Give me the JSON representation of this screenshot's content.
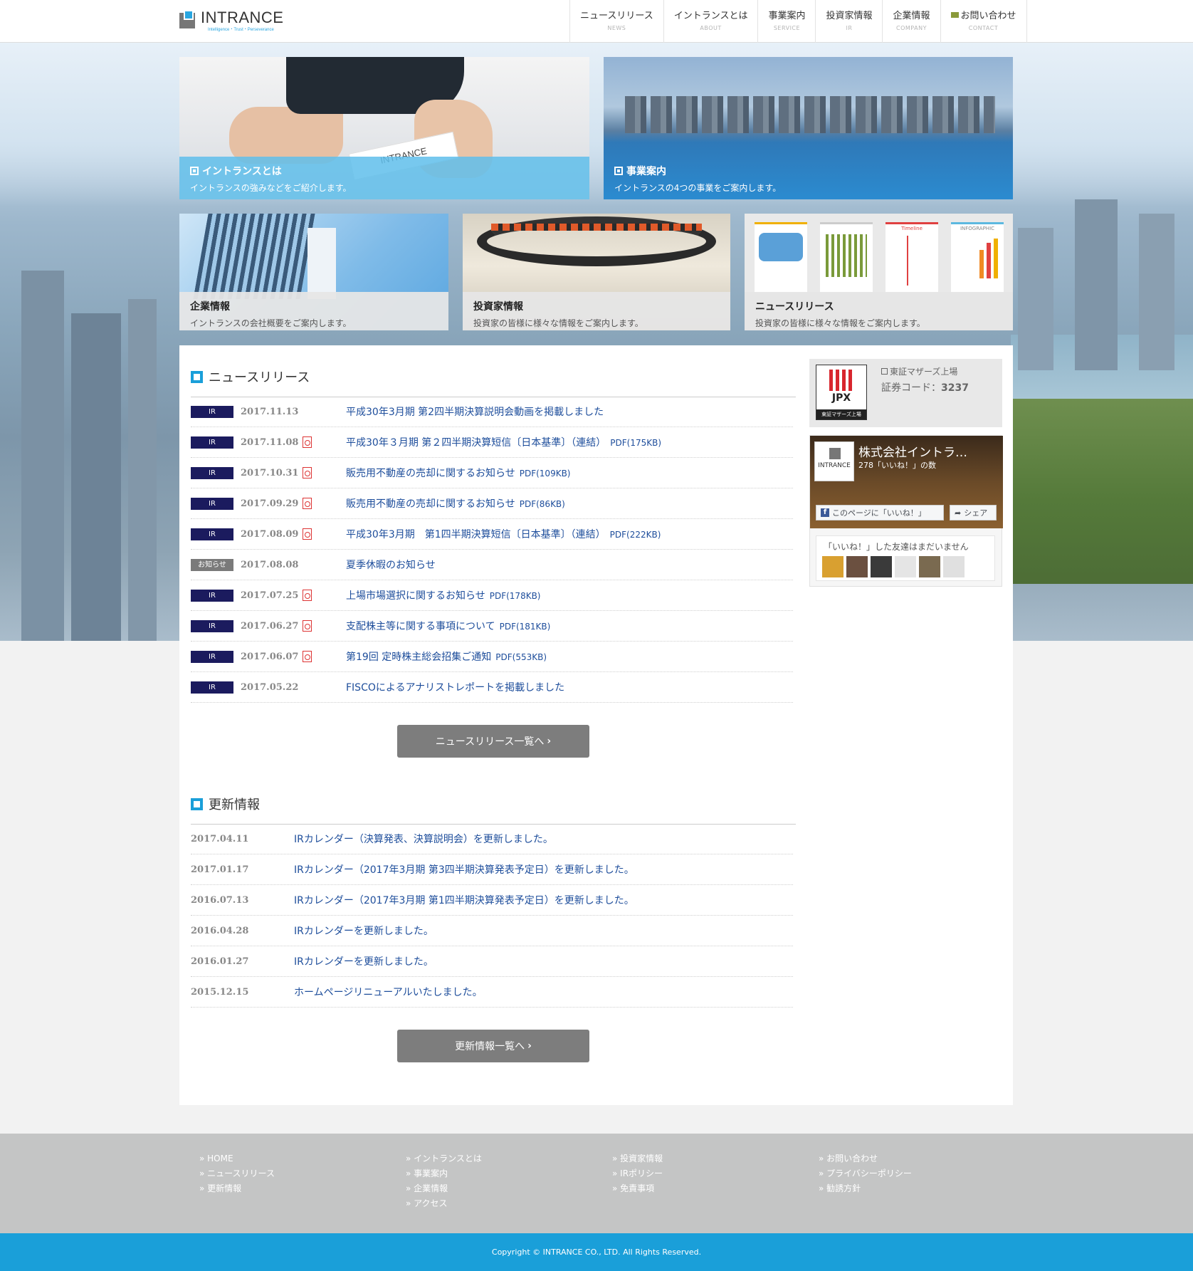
{
  "header": {
    "logo_text": "INTRANCE",
    "logo_sub": "Intelligence・Trust・Perseverance",
    "nav": [
      {
        "jp": "ニュースリリース",
        "en": "NEWS"
      },
      {
        "jp": "イントランスとは",
        "en": "ABOUT"
      },
      {
        "jp": "事業案内",
        "en": "SERVICE"
      },
      {
        "jp": "投資家情報",
        "en": "IR"
      },
      {
        "jp": "企業情報",
        "en": "COMPANY"
      },
      {
        "jp": "お問い合わせ",
        "en": "CONTACT"
      }
    ]
  },
  "tiles": {
    "about": {
      "title": "イントランスとは",
      "desc": "イントランスの強みなどをご紹介します。",
      "card_text": "INTRANCE"
    },
    "service": {
      "title": "事業案内",
      "desc": "イントランスの4つの事業をご案内します。"
    },
    "company": {
      "title": "企業情報",
      "desc": "イントランスの会社概要をご案内します。"
    },
    "ir": {
      "title": "投資家情報",
      "desc": "投資家の皆様に様々な情報をご案内します。"
    },
    "news": {
      "title": "ニュースリリース",
      "desc": "投資家の皆様に様々な情報をご案内します。",
      "infographic": "INFOGRAPHIC",
      "timeline": "Timeline"
    }
  },
  "news": {
    "heading": "ニュースリリース",
    "items": [
      {
        "tag": "IR",
        "date": "2017.11.13",
        "title": "平成30年3月期 第2四半期決算説明会動画を掲載しました",
        "pdf": false,
        "size": ""
      },
      {
        "tag": "IR",
        "date": "2017.11.08",
        "title": "平成30年３月期 第２四半期決算短信〔日本基準〕（連結）",
        "pdf": true,
        "size": "PDF(175KB)"
      },
      {
        "tag": "IR",
        "date": "2017.10.31",
        "title": "販売用不動産の売却に関するお知らせ",
        "pdf": true,
        "size": "PDF(109KB)"
      },
      {
        "tag": "IR",
        "date": "2017.09.29",
        "title": "販売用不動産の売却に関するお知らせ",
        "pdf": true,
        "size": "PDF(86KB)"
      },
      {
        "tag": "IR",
        "date": "2017.08.09",
        "title": "平成30年3月期　第1四半期決算短信〔日本基準〕（連結）",
        "pdf": true,
        "size": "PDF(222KB)"
      },
      {
        "tag": "お知らせ",
        "date": "2017.08.08",
        "title": "夏季休暇のお知らせ",
        "pdf": false,
        "size": ""
      },
      {
        "tag": "IR",
        "date": "2017.07.25",
        "title": "上場市場選択に関するお知らせ",
        "pdf": true,
        "size": "PDF(178KB)"
      },
      {
        "tag": "IR",
        "date": "2017.06.27",
        "title": "支配株主等に関する事項について",
        "pdf": true,
        "size": "PDF(181KB)"
      },
      {
        "tag": "IR",
        "date": "2017.06.07",
        "title": "第19回 定時株主総会招集ご通知",
        "pdf": true,
        "size": "PDF(553KB)"
      },
      {
        "tag": "IR",
        "date": "2017.05.22",
        "title": "FISCOによるアナリストレポートを掲載しました",
        "pdf": false,
        "size": ""
      }
    ],
    "more_label": "ニュースリリース一覧へ"
  },
  "updates": {
    "heading": "更新情報",
    "items": [
      {
        "date": "2017.04.11",
        "title": "IRカレンダー（決算発表、決算説明会）を更新しました。"
      },
      {
        "date": "2017.01.17",
        "title": "IRカレンダー（2017年3月期 第3四半期決算発表予定日）を更新しました。"
      },
      {
        "date": "2016.07.13",
        "title": "IRカレンダー（2017年3月期 第1四半期決算発表予定日）を更新しました。"
      },
      {
        "date": "2016.04.28",
        "title": "IRカレンダーを更新しました。"
      },
      {
        "date": "2016.01.27",
        "title": "IRカレンダーを更新しました。"
      },
      {
        "date": "2015.12.15",
        "title": "ホームページリニューアルいたしました。"
      }
    ],
    "more_label": "更新情報一覧へ"
  },
  "sidebar": {
    "market": "東証マザーズ上場",
    "code_label": "証券コード：",
    "code": "3237",
    "jpx_text": "JPX",
    "jpx_sub": "東証マザーズ上場",
    "fb_name": "株式会社イントラ…",
    "fb_likes": "278「いいね！」の数",
    "fb_like_btn": "このページに「いいね！」",
    "fb_share_btn": "シェア",
    "fb_friends": "「いいね！」した友達はまだいません",
    "fb_logo_text": "INTRANCE"
  },
  "footer": {
    "col1": [
      "HOME",
      "ニュースリリース",
      "更新情報"
    ],
    "col2": [
      "イントランスとは",
      "事業案内",
      "企業情報",
      "アクセス"
    ],
    "col3": [
      "投資家情報",
      "IRポリシー",
      "免責事項"
    ],
    "col4": [
      "お問い合わせ",
      "プライバシーポリシー",
      "勧誘方針"
    ],
    "copyright": "Copyright © INTRANCE CO., LTD. All Rights Reserved."
  },
  "colors": {
    "accent": "#1a9fd9",
    "ir_tag": "#1b1b5e",
    "link": "#1d4d9b",
    "footer": "#c4c5c5"
  }
}
